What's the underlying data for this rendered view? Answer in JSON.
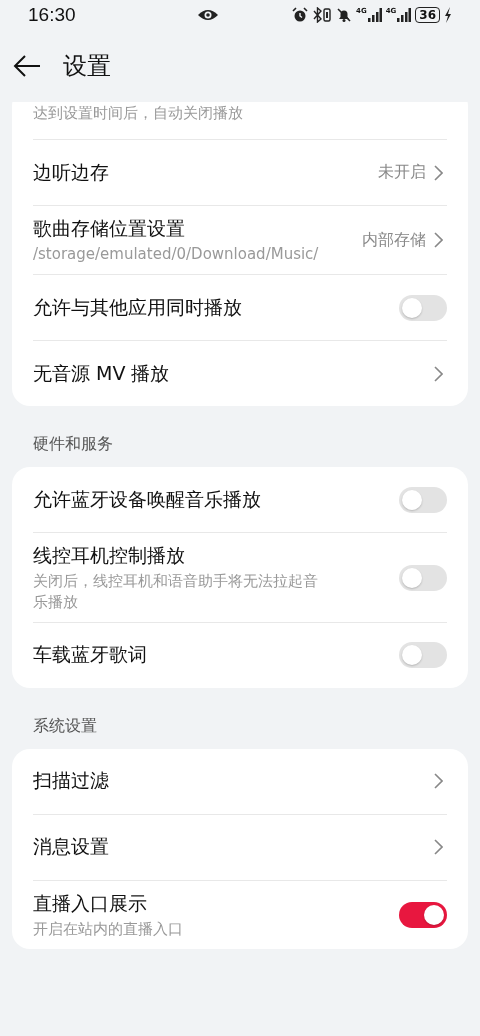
{
  "status_bar": {
    "time": "16:30",
    "signals": [
      {
        "network": "4G"
      },
      {
        "network": "4G"
      }
    ],
    "battery": "36",
    "charging": true
  },
  "header": {
    "title": "设置"
  },
  "groups": [
    {
      "rows": [
        {
          "kind": "note",
          "subtitle": "达到设置时间后，自动关闭播放"
        },
        {
          "kind": "link",
          "label": "边听边存",
          "value": "未开启"
        },
        {
          "kind": "link",
          "label": "歌曲存储位置设置",
          "subtitle": "/storage/emulated/0/Download/Music/",
          "value": "内部存储"
        },
        {
          "kind": "toggle",
          "label": "允许与其他应用同时播放",
          "on": false
        },
        {
          "kind": "link",
          "label": "无音源 MV 播放"
        }
      ]
    },
    {
      "heading": "硬件和服务",
      "rows": [
        {
          "kind": "toggle",
          "label": "允许蓝牙设备唤醒音乐播放",
          "on": false
        },
        {
          "kind": "toggle",
          "label": "线控耳机控制播放",
          "subtitle": "关闭后，线控耳机和语音助手将无法拉起音乐播放",
          "on": false
        },
        {
          "kind": "toggle",
          "label": "车载蓝牙歌词",
          "on": false
        }
      ]
    },
    {
      "heading": "系统设置",
      "rows": [
        {
          "kind": "link",
          "label": "扫描过滤"
        },
        {
          "kind": "link",
          "label": "消息设置"
        },
        {
          "kind": "toggle",
          "label": "直播入口展示",
          "subtitle": "开启在站内的直播入口",
          "on": true
        }
      ]
    }
  ]
}
